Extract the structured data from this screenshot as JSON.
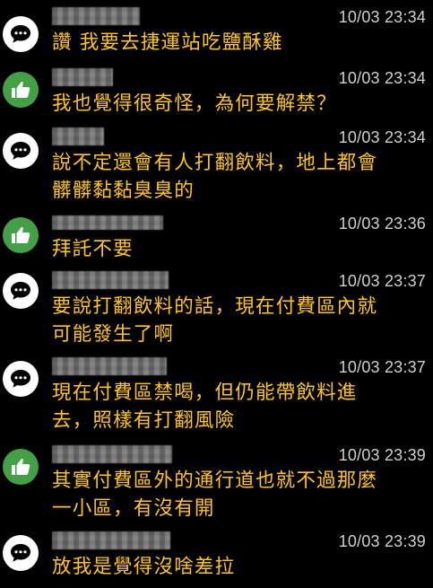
{
  "colors": {
    "background": "#000000",
    "message_text": "#ffc61a",
    "timestamp_text": "#cfcfcf",
    "push_icon_bg": "#43a047",
    "neutral_icon_bg": "#ffffff"
  },
  "comments": [
    {
      "type": "neutral",
      "icon": "speech-bubble-icon",
      "time": "10/03 23:34",
      "text": "讚 我要去捷運站吃鹽酥雞"
    },
    {
      "type": "push",
      "icon": "thumbs-up-icon",
      "time": "10/03 23:34",
      "text": "我也覺得很奇怪，為何要解禁？"
    },
    {
      "type": "neutral",
      "icon": "speech-bubble-icon",
      "time": "10/03 23:34",
      "text": "說不定還會有人打翻飲料，地上都會\n髒髒黏黏臭臭的"
    },
    {
      "type": "push",
      "icon": "thumbs-up-icon",
      "time": "10/03 23:36",
      "text": "拜託不要"
    },
    {
      "type": "neutral",
      "icon": "speech-bubble-icon",
      "time": "10/03 23:37",
      "text": "要說打翻飲料的話，現在付費區內就\n可能發生了啊"
    },
    {
      "type": "neutral",
      "icon": "speech-bubble-icon",
      "time": "10/03 23:37",
      "text": "現在付費區禁喝，但仍能帶飲料進\n去，照樣有打翻風險"
    },
    {
      "type": "push",
      "icon": "thumbs-up-icon",
      "time": "10/03 23:39",
      "text": "其實付費區外的通行道也就不過那麼\n一小區，有沒有開"
    },
    {
      "type": "neutral",
      "icon": "speech-bubble-icon",
      "time": "10/03 23:39",
      "text": "放我是覺得沒啥差拉"
    }
  ]
}
